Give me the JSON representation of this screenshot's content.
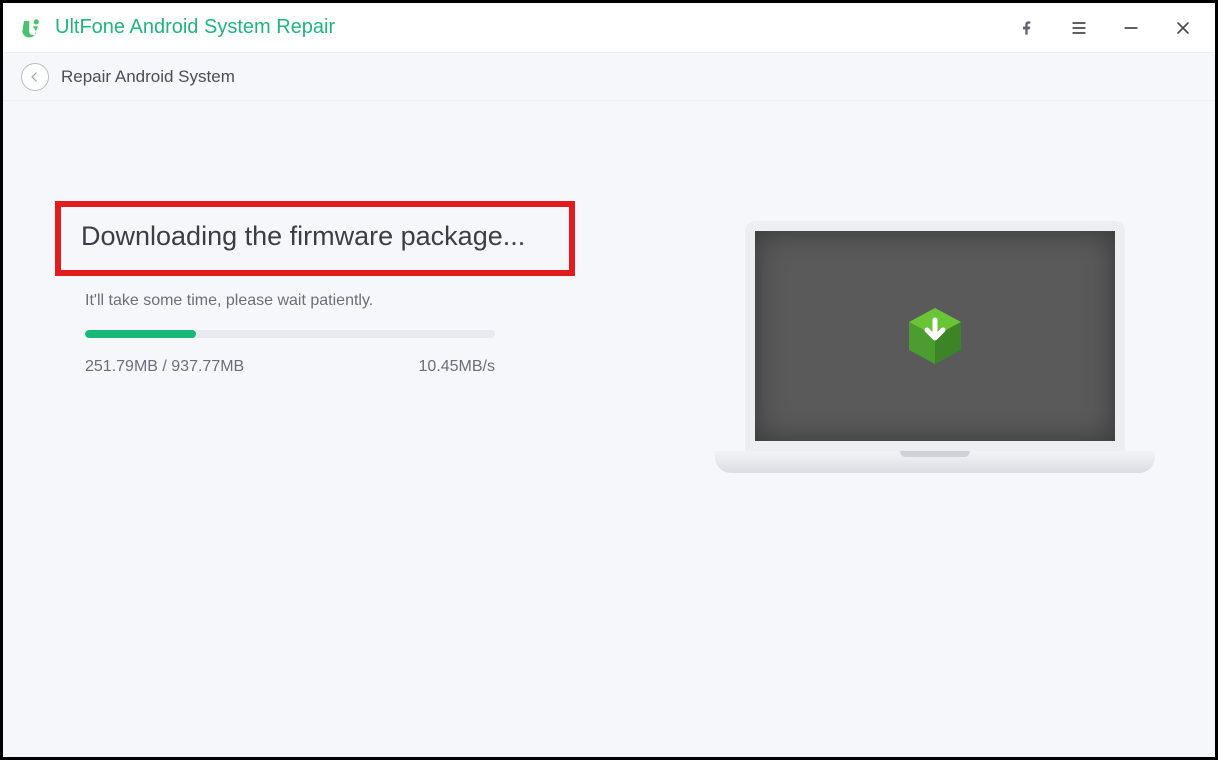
{
  "app": {
    "title": "UltFone Android System Repair"
  },
  "subheader": {
    "title": "Repair Android System"
  },
  "main": {
    "heading": "Downloading the firmware package...",
    "subtext": "It'll take some time, please wait patiently.",
    "downloaded": "251.79MB / 937.77MB",
    "speed": "10.45MB/s",
    "progress_percent": 27
  },
  "colors": {
    "accent": "#17b978",
    "highlight_border": "#e21c1c"
  }
}
